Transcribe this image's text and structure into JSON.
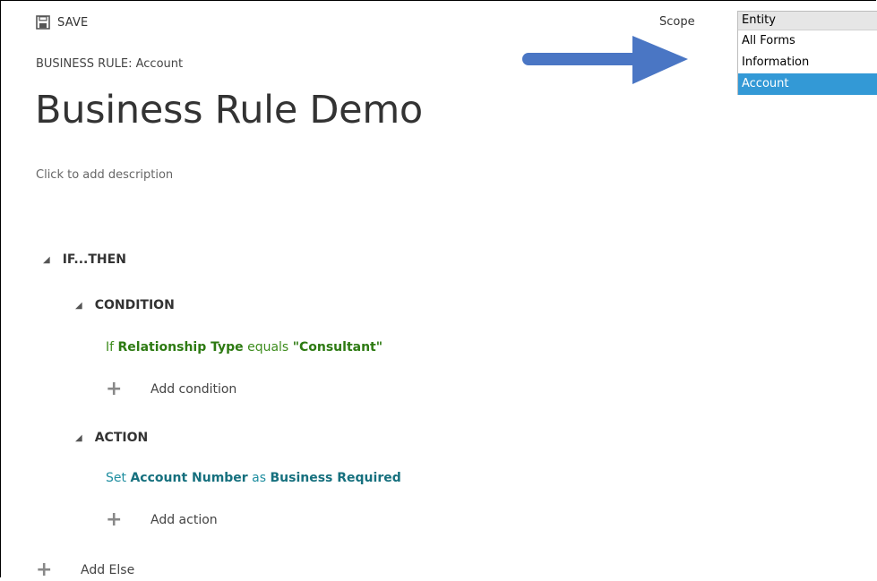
{
  "toolbar": {
    "save_label": "SAVE",
    "save_icon": "floppy-disk-icon"
  },
  "header": {
    "record_label": "BUSINESS RULE: Account",
    "title": "Business Rule Demo",
    "description_placeholder": "Click to add description"
  },
  "scope": {
    "label": "Scope",
    "options": [
      "Entity",
      "All Forms",
      "Information",
      "Account"
    ],
    "selected": "Account",
    "selected_color": "#3399d6"
  },
  "annotation": {
    "arrow_color": "#4a76c4"
  },
  "rule": {
    "ifthen_label": "IF...THEN",
    "condition": {
      "label": "CONDITION",
      "prefix": "If",
      "field": "Relationship Type",
      "operator": "equals",
      "value": "\"Consultant\"",
      "color": "#3c8c1c",
      "add_label": "Add condition"
    },
    "action": {
      "label": "ACTION",
      "prefix": "Set",
      "field": "Account Number",
      "operator": "as",
      "value": "Business Required",
      "color": "#1f8ea0",
      "add_label": "Add action"
    },
    "else_label": "Add Else"
  }
}
